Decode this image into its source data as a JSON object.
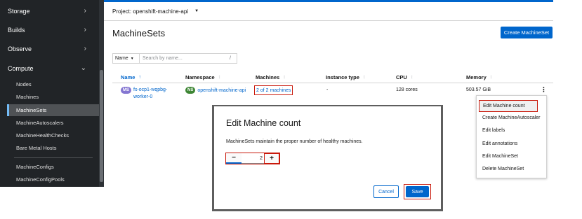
{
  "sidebar": {
    "sections": [
      {
        "label": "Storage",
        "chevron": "›"
      },
      {
        "label": "Builds",
        "chevron": "›"
      },
      {
        "label": "Observe",
        "chevron": "›"
      },
      {
        "label": "Compute",
        "chevron": "⌄"
      }
    ],
    "items": [
      {
        "label": "Nodes"
      },
      {
        "label": "Machines"
      },
      {
        "label": "MachineSets",
        "active": true
      },
      {
        "label": "MachineAutoscalers"
      },
      {
        "label": "MachineHealthChecks"
      },
      {
        "label": "Bare Metal Hosts"
      },
      {
        "label": "MachineConfigs"
      },
      {
        "label": "MachineConfigPools"
      }
    ]
  },
  "project": {
    "label": "Project: openshift-machine-api",
    "caret": "▼"
  },
  "page": {
    "title": "MachineSets",
    "create_label": "Create MachineSet"
  },
  "filter": {
    "type": "Name",
    "caret": "▼",
    "placeholder": "Search by name...",
    "slash": "/"
  },
  "table": {
    "columns": [
      {
        "label": "Name",
        "sort": "↑"
      },
      {
        "label": "Namespace",
        "sort": "↕"
      },
      {
        "label": "Machines",
        "sort": "↕"
      },
      {
        "label": "Instance type",
        "sort": "↕"
      },
      {
        "label": "CPU",
        "sort": "↕"
      },
      {
        "label": "Memory",
        "sort": "↕"
      }
    ],
    "row": {
      "name_badge": "MS",
      "name_line1": "fs-ocp1-wqpbg-",
      "name_line2": "worker-0",
      "ns_badge": "NS",
      "namespace": "openshift-machine-api",
      "machines": "2 of 2 machines",
      "instance_type": "-",
      "cpu": "128 cores",
      "memory": "503.57 GiB",
      "kebab": "⋮"
    }
  },
  "menu": {
    "items": [
      "Edit Machine count",
      "Create MachineAutoscaler",
      "Edit labels",
      "Edit annotations",
      "Edit MachineSet",
      "Delete MachineSet"
    ]
  },
  "modal": {
    "title": "Edit Machine count",
    "description": "MachineSets maintain the proper number of healthy machines.",
    "minus": "−",
    "value": "2",
    "plus": "+",
    "cancel": "Cancel",
    "save": "Save"
  },
  "colors": {
    "accent": "#0066cc",
    "sidebar": "#212427",
    "highlight": "#c9190b"
  }
}
